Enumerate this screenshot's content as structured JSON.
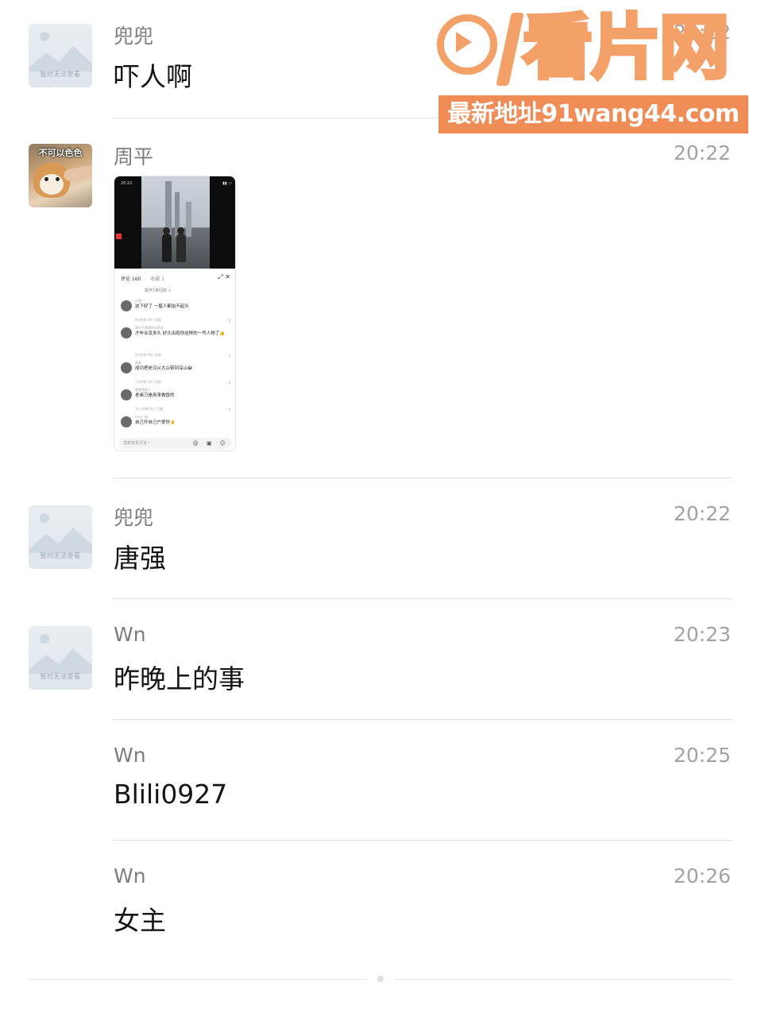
{
  "messages": [
    {
      "sender": "兜兜",
      "time": "20:22",
      "content": "吓人啊",
      "avatar_text": "暂时无法查看"
    },
    {
      "sender": "周平",
      "time": "20:22",
      "avatar_label": "不可以色色",
      "image": {
        "status_time": "20:22",
        "comments_tab": "评论 160",
        "favorites_tab": "收藏 1",
        "expand_text": "展开1条回复 ∨",
        "input_placeholder": "发条有爱评论~",
        "comments": [
          {
            "name": "过客",
            "text": "这下好了 一屋人都抬不起头",
            "meta": "9小时前 四川    回复",
            "likes": "♡3"
          },
          {
            "name": "我也不是哪的你是谁",
            "text": "才毕业没多久 好久出现你这样的一号人物了👍",
            "meta": "9小时前 四川    回复",
            "likes": "♡3"
          },
          {
            "name": "青春",
            "text": "成功把老汉从大山带到深山😂",
            "meta": "7小时前 四川    回复",
            "likes": "♡3"
          },
          {
            "name": "谁都是客人",
            "text": "老弟刀是用来做饭的",
            "meta": "11小时前 四川    回复",
            "likes": "♡4"
          },
          {
            "name": "Lucy h@",
            "text": "自己开自己户爱你🤞",
            "meta": "",
            "likes": ""
          }
        ]
      }
    },
    {
      "sender": "兜兜",
      "time": "20:22",
      "content": "唐强",
      "avatar_text": "暂时无法查看"
    },
    {
      "sender": "Wn",
      "time": "20:23",
      "content": "昨晚上的事",
      "avatar_text": "暂时无法查看"
    },
    {
      "sender": "Wn",
      "time": "20:25",
      "content": "Blili0927"
    },
    {
      "sender": "Wn",
      "time": "20:26",
      "content": "女主"
    }
  ],
  "watermark": {
    "brand": "看片网",
    "digits": "91",
    "url": "最新地址91wang44.com",
    "color": "#f4a069"
  },
  "icons": {
    "placeholder_avatar": "image-placeholder-icon",
    "input_icons": "@ ▣ ☺"
  }
}
